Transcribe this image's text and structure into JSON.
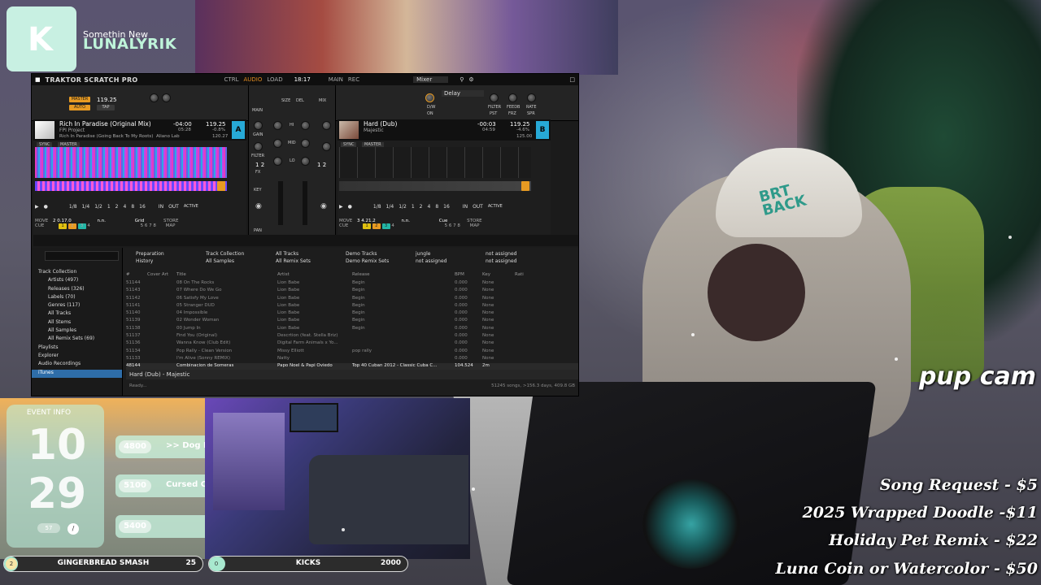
{
  "branding": {
    "logo_glyph": "K",
    "subtitle": "Somethin New",
    "name": "LUNALYRIK"
  },
  "traktor": {
    "app_title": "TRAKTOR SCRATCH PRO",
    "clock": "18:17",
    "top_labels": [
      "CTRL",
      "AUDIO",
      "LOAD",
      "MAIN",
      "REC"
    ],
    "mixer_dropdown": "Mixer",
    "fx_unit": {
      "left_master": "MASTER",
      "left_auto": "AUTO",
      "left_tempo": "119.25",
      "left_tap": "TAP",
      "right_effect": "Delay",
      "right_buttons": [
        "PST",
        "FRZ",
        "SPR"
      ],
      "right_knob_labels": [
        "FILTER",
        "FEEDB",
        "RATE"
      ],
      "dw_label": "D/W",
      "on_label": "ON"
    },
    "deck_a": {
      "letter": "A",
      "title": "Rich In Paradise (Original Mix)",
      "artist": "FPI Project",
      "next": "Rich In Paradise (Going Back To My Roots)",
      "label": "Aliano Lab",
      "time_remaining": "-04:00",
      "time_total": "05:28",
      "bpm": "119.25",
      "pitch": "-0.8%",
      "key_bpm": "120.27",
      "sync": "SYNC",
      "master": "MASTER",
      "loop_sizes": [
        "1/8",
        "1/4",
        "1/2",
        "1",
        "2",
        "4",
        "8",
        "16"
      ],
      "in": "IN",
      "out": "OUT",
      "active": "ACTIVE",
      "move": "MOVE",
      "cue": "CUE",
      "grid": "GRID",
      "move_value": "2",
      "move_amount": "0.17.0",
      "move_unit": "n.n.",
      "move_mode": "Grid",
      "store": "STORE",
      "map": "MAP",
      "hotcues": [
        "1",
        "2",
        "3",
        "4",
        "5",
        "6",
        "7",
        "8"
      ]
    },
    "deck_b": {
      "letter": "B",
      "title": "Hard (Dub)",
      "artist": "Majestic",
      "time_remaining": "-00:03",
      "time_total": "04:59",
      "bpm": "119.25",
      "pitch": "-4.6%",
      "key_bpm": "125.00",
      "sync": "SYNC",
      "master": "MASTER",
      "loop_sizes": [
        "1/8",
        "1/4",
        "1/2",
        "1",
        "2",
        "4",
        "8",
        "16"
      ],
      "in": "IN",
      "out": "OUT",
      "active": "ACTIVE",
      "move": "MOVE",
      "cue": "CUE",
      "grid": "GRID",
      "move_value": "3",
      "move_amount": "4.21.2",
      "move_unit": "n.n.",
      "move_mode": "Cue",
      "store": "STORE",
      "map": "MAP",
      "hotcues": [
        "1",
        "2",
        "3",
        "4",
        "5",
        "6",
        "7",
        "8"
      ]
    },
    "mixer": {
      "labels": [
        "GAIN",
        "HI",
        "MID",
        "LO",
        "FILTER",
        "FX",
        "KEY",
        "PAN"
      ],
      "fx_numbers": [
        "1",
        "2"
      ],
      "main": "MAIN",
      "mix": "MIX",
      "size": "SIZE",
      "del": "DEL"
    },
    "browser": {
      "tree": [
        {
          "label": "Track Collection",
          "top": true
        },
        {
          "label": "Artists (497)"
        },
        {
          "label": "Releases (326)"
        },
        {
          "label": "Labels (70)"
        },
        {
          "label": "Genres (117)"
        },
        {
          "label": "All Tracks"
        },
        {
          "label": "All Stems"
        },
        {
          "label": "All Samples"
        },
        {
          "label": "All Remix Sets (69)"
        },
        {
          "label": "Playlists",
          "top": true
        },
        {
          "label": "Explorer",
          "top": true
        },
        {
          "label": "Audio Recordings",
          "top": true
        },
        {
          "label": "iTunes",
          "top": true,
          "selected": true
        }
      ],
      "favorites": [
        "Preparation",
        "Track Collection",
        "All Tracks",
        "Demo Tracks",
        "jungle",
        "not assigned",
        "History",
        "All Samples",
        "All Remix Sets",
        "Demo Remix Sets",
        "not assigned",
        "not assigned"
      ],
      "columns": [
        "#",
        "Cover Art",
        "Title",
        "Artist",
        "Release",
        "BPM",
        "Key",
        "Rati"
      ],
      "rows": [
        [
          "51144",
          "",
          "08 On The Rocks",
          "Lion Babe",
          "Begin",
          "0.000",
          "None",
          ""
        ],
        [
          "51143",
          "",
          "07 Where Do We Go",
          "Lion Babe",
          "Begin",
          "0.000",
          "None",
          ""
        ],
        [
          "51142",
          "",
          "06 Satisfy My Love",
          "Lion Babe",
          "Begin",
          "0.000",
          "None",
          ""
        ],
        [
          "51141",
          "",
          "05 Stranger DUD",
          "Lion Babe",
          "Begin",
          "0.000",
          "None",
          ""
        ],
        [
          "51140",
          "",
          "04 Impossible",
          "Lion Babe",
          "Begin",
          "0.000",
          "None",
          ""
        ],
        [
          "51139",
          "",
          "02 Wonder Woman",
          "Lion Babe",
          "Begin",
          "0.000",
          "None",
          ""
        ],
        [
          "51138",
          "",
          "00 Jump In",
          "Lion Babe",
          "Begin",
          "0.000",
          "None",
          ""
        ],
        [
          "51137",
          "",
          "Find You (Original)",
          "Descrtion (feat. Stella Briz)",
          "",
          "0.000",
          "None",
          ""
        ],
        [
          "51136",
          "",
          "Wanna Know (Club Edit)",
          "Digital Farm Animals x Yo...",
          "",
          "0.000",
          "None",
          ""
        ],
        [
          "51134",
          "",
          "Pop Rally - Clean Version",
          "Missy Elliott",
          "pop rally",
          "0.000",
          "None",
          ""
        ],
        [
          "51133",
          "",
          "I'm Alive (Sonny REMIX)",
          "Natty",
          "",
          "0.000",
          "None",
          ""
        ],
        [
          "48144",
          "",
          "Combinacion de Someras",
          "Papo Noel & Papi Oviedo",
          "Top 40 Cuban 2012 - Classic Cuba C...",
          "104.524",
          "2m",
          ""
        ]
      ],
      "preview_track": "Hard (Dub) - Majestic",
      "status_left": "Ready...",
      "status_right": "51245 songs, >156.3 days, 409.8 GB"
    }
  },
  "event_info": {
    "heading": "EVENT INFO",
    "month": "10",
    "day": "29",
    "small_badge": "57",
    "small_dot": "/",
    "goals": [
      {
        "amount": "4800",
        "label": ">> Dog Feast"
      },
      {
        "amount": "5100",
        "label": "Cursed Closet Cosplay"
      },
      {
        "amount": "5400",
        "label": ""
      }
    ]
  },
  "bars": [
    {
      "num": "2",
      "label": "GINGERBREAD SMASH",
      "value": "25",
      "fill": 0.05
    },
    {
      "num": "0",
      "label": "KICKS",
      "value": "2000",
      "fill": 0.08
    }
  ],
  "pup_cam": "pup cam",
  "requests": [
    "Song Request - $5",
    "2025 Wrapped Doodle -$11",
    "Holiday Pet Remix - $22",
    "Luna Coin or Watercolor - $50"
  ]
}
